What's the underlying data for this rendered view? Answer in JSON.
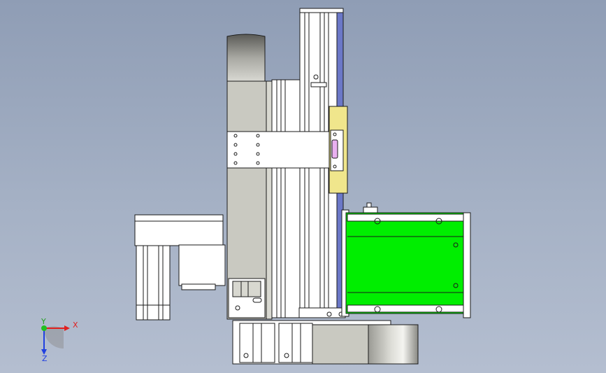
{
  "view": {
    "background_top": "#8f9db5",
    "background_bottom": "#b4bed0",
    "part_colors": {
      "steel": "#ffffff",
      "housing": "#c9c9c1",
      "slider": "#f0e68c",
      "gripper_body": "#00ee00",
      "rail": "#6b78c8",
      "connector": "#e9b0f0",
      "outline": "#1a1a1a"
    }
  },
  "triad": {
    "x_label": "X",
    "y_label": "Y",
    "z_label": "Z",
    "x_color": "#e02020",
    "y_color": "#20c020",
    "z_color": "#2040e0"
  }
}
